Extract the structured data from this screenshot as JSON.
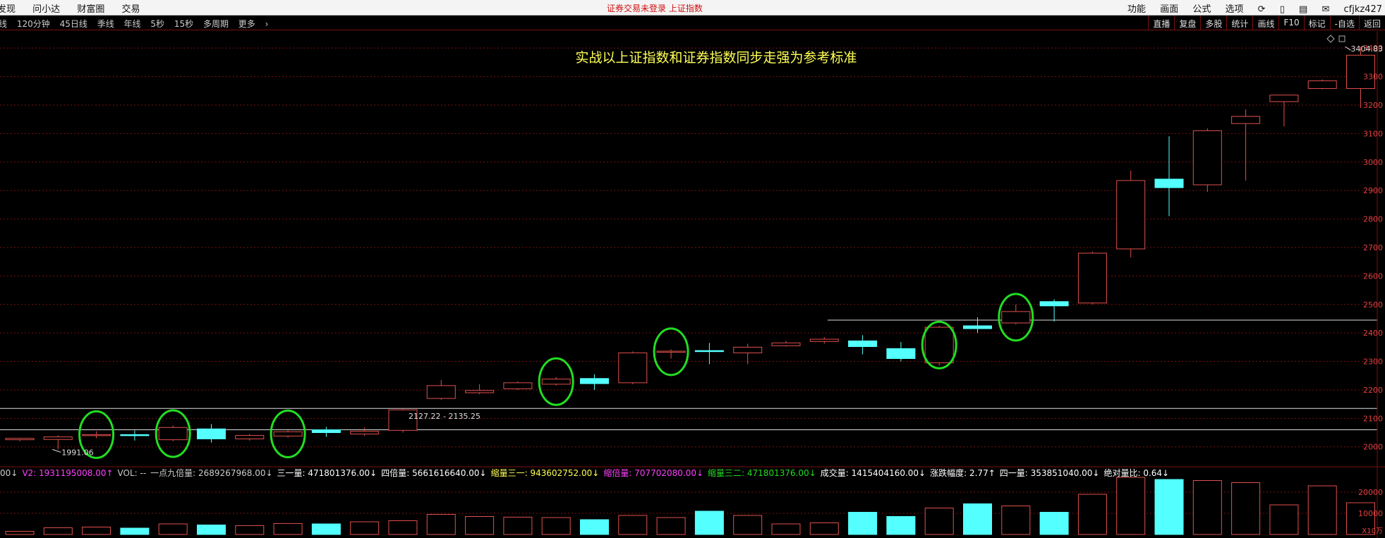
{
  "menubar": {
    "left_items": [
      "发现",
      "问小达",
      "财富圈",
      "交易"
    ],
    "center_text": "证券交易未登录  上证指数",
    "right_items": [
      "功能",
      "画面",
      "公式",
      "选项"
    ],
    "user": "cfjkz427"
  },
  "toolbar": {
    "left_items": [
      "线",
      "120分钟",
      "45日线",
      "季线",
      "年线",
      "5秒",
      "15秒",
      "多周期",
      "更多"
    ],
    "right_items": [
      "直播",
      "复盘",
      "多股",
      "统计",
      "画线",
      "F10",
      "标记",
      "-自选",
      "返回"
    ]
  },
  "colors": {
    "up": "#e0504c",
    "down": "#54ffff",
    "grid": "#7a1010",
    "axis_text": "#e04040",
    "title": "#ffff55",
    "highlight_circle": "#22dd22"
  },
  "info_bar": [
    {
      "text": "00↓",
      "color": "#cccccc"
    },
    {
      "text": "V2: 1931195008.00↑",
      "color": "#ff40ff"
    },
    {
      "text": "VOL: --",
      "color": "#cccccc"
    },
    {
      "text": "一点九倍量: 2689267968.00↓",
      "color": "#cccccc"
    },
    {
      "text": "三一量: 471801376.00↓",
      "color": "#ffffff"
    },
    {
      "text": "四倍量: 5661616640.00↓",
      "color": "#ffffff"
    },
    {
      "text": "缩量三一: 943602752.00↓",
      "color": "#ffff55"
    },
    {
      "text": "缩倍量: 707702080.00↓",
      "color": "#ff40ff"
    },
    {
      "text": "缩量三二: 471801376.00↓",
      "color": "#22dd22"
    },
    {
      "text": "成交量: 1415404160.00↓",
      "color": "#ffffff"
    },
    {
      "text": "涨跌幅度: 2.77↑",
      "color": "#ffffff"
    },
    {
      "text": "四一量: 353851040.00↓",
      "color": "#ffffff"
    },
    {
      "text": "绝对量比: 0.64↓",
      "color": "#ffffff"
    }
  ],
  "chart_data": {
    "type": "candlestick",
    "title": "实战以上证指数和证券指数同步走强为参考标准",
    "y_ticks": [
      2000,
      2100,
      2200,
      2300,
      2400,
      2500,
      2600,
      2700,
      2800,
      2900,
      3000,
      3100,
      3200,
      3300,
      3400
    ],
    "ylim": [
      1935,
      3445
    ],
    "vol_ticks": [
      {
        "value": 10000,
        "label": "10000"
      },
      {
        "value": 20000,
        "label": "20000"
      }
    ],
    "vol_ylim": [
      0,
      25000
    ],
    "vol_unit": "X10万",
    "candles": [
      {
        "o": 2025,
        "c": 2030,
        "h": 2032,
        "l": 2020,
        "v": 1500
      },
      {
        "o": 2026,
        "c": 2035,
        "h": 2040,
        "l": 1991,
        "v": 3200
      },
      {
        "o": 2043,
        "c": 2043,
        "h": 2055,
        "l": 2030,
        "v": 3500
      },
      {
        "o": 2043,
        "c": 2040,
        "h": 2058,
        "l": 2022,
        "v": 3000
      },
      {
        "o": 2025,
        "c": 2068,
        "h": 2075,
        "l": 2020,
        "v": 5000
      },
      {
        "o": 2063,
        "c": 2028,
        "h": 2080,
        "l": 2015,
        "v": 4500
      },
      {
        "o": 2028,
        "c": 2040,
        "h": 2045,
        "l": 2022,
        "v": 4200
      },
      {
        "o": 2038,
        "c": 2053,
        "h": 2058,
        "l": 2032,
        "v": 5200
      },
      {
        "o": 2060,
        "c": 2050,
        "h": 2070,
        "l": 2035,
        "v": 5000
      },
      {
        "o": 2045,
        "c": 2055,
        "h": 2068,
        "l": 2038,
        "v": 6000
      },
      {
        "o": 2058,
        "c": 2130,
        "h": 2135,
        "l": 2050,
        "v": 6500
      },
      {
        "o": 2170,
        "c": 2215,
        "h": 2235,
        "l": 2165,
        "v": 9500
      },
      {
        "o": 2190,
        "c": 2198,
        "h": 2220,
        "l": 2185,
        "v": 8500
      },
      {
        "o": 2204,
        "c": 2225,
        "h": 2230,
        "l": 2200,
        "v": 8200
      },
      {
        "o": 2220,
        "c": 2238,
        "h": 2245,
        "l": 2215,
        "v": 8000
      },
      {
        "o": 2240,
        "c": 2222,
        "h": 2255,
        "l": 2200,
        "v": 7000
      },
      {
        "o": 2225,
        "c": 2330,
        "h": 2335,
        "l": 2220,
        "v": 9000
      },
      {
        "o": 2332,
        "c": 2336,
        "h": 2342,
        "l": 2310,
        "v": 8000
      },
      {
        "o": 2338,
        "c": 2336,
        "h": 2365,
        "l": 2290,
        "v": 11000
      },
      {
        "o": 2330,
        "c": 2350,
        "h": 2362,
        "l": 2290,
        "v": 9000
      },
      {
        "o": 2355,
        "c": 2365,
        "h": 2372,
        "l": 2352,
        "v": 5000
      },
      {
        "o": 2370,
        "c": 2378,
        "h": 2385,
        "l": 2362,
        "v": 5500
      },
      {
        "o": 2372,
        "c": 2352,
        "h": 2392,
        "l": 2325,
        "v": 10500
      },
      {
        "o": 2345,
        "c": 2310,
        "h": 2368,
        "l": 2300,
        "v": 8500
      },
      {
        "o": 2295,
        "c": 2420,
        "h": 2425,
        "l": 2285,
        "v": 12500
      },
      {
        "o": 2425,
        "c": 2415,
        "h": 2455,
        "l": 2400,
        "v": 14500
      },
      {
        "o": 2435,
        "c": 2475,
        "h": 2500,
        "l": 2430,
        "v": 13500
      },
      {
        "o": 2510,
        "c": 2495,
        "h": 2518,
        "l": 2440,
        "v": 10500
      },
      {
        "o": 2505,
        "c": 2680,
        "h": 2685,
        "l": 2500,
        "v": 19000
      },
      {
        "o": 2695,
        "c": 2935,
        "h": 2970,
        "l": 2665,
        "v": 27000
      },
      {
        "o": 2940,
        "c": 2910,
        "h": 3090,
        "l": 2810,
        "v": 26000
      },
      {
        "o": 2920,
        "c": 3110,
        "h": 3118,
        "l": 2895,
        "v": 25500
      },
      {
        "o": 3135,
        "c": 3160,
        "h": 3185,
        "l": 2935,
        "v": 24500
      },
      {
        "o": 3212,
        "c": 3235,
        "h": 3235,
        "l": 3125,
        "v": 14000
      },
      {
        "o": 3258,
        "c": 3285,
        "h": 3290,
        "l": 3255,
        "v": 23000
      },
      {
        "o": 3258,
        "c": 3375,
        "h": 3404.83,
        "l": 3190,
        "v": 15000
      }
    ],
    "annotations": {
      "low_label": "1991.06",
      "high_label": "3404.83",
      "range_label": "2127.22 - 2135.25"
    },
    "reference_lines": [
      2060,
      2135,
      2445
    ],
    "highlighted_candles": [
      2,
      4,
      7,
      14,
      17,
      24,
      26
    ]
  }
}
